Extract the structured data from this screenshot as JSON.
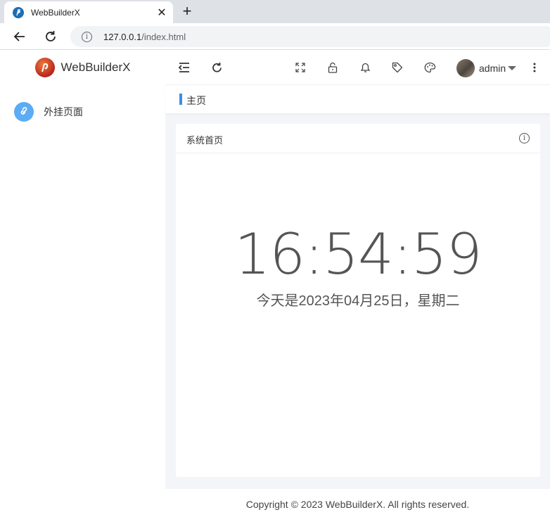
{
  "browser": {
    "tab_title": "WebBuilderX",
    "close_glyph": "✕",
    "new_tab_glyph": "+",
    "url_host": "127.0.0.1",
    "url_path": "/index.html",
    "info_glyph": "i"
  },
  "sidebar": {
    "brand_name": "WebBuilderX",
    "items": [
      {
        "label": "外挂页面",
        "icon": "link-icon"
      }
    ]
  },
  "header": {
    "icons": [
      "menu-fold-icon",
      "refresh-icon",
      "fullscreen-icon",
      "lock-icon",
      "bell-icon",
      "tag-icon",
      "palette-icon",
      "more-icon"
    ],
    "username": "admin"
  },
  "breadcrumb": {
    "current": "主页"
  },
  "card": {
    "title": "系统首页",
    "info_glyph": "i",
    "time": "16:54:59",
    "date": "今天是2023年04月25日，星期二"
  },
  "footer": {
    "copyright": "Copyright © 2023 WebBuilderX. All rights reserved."
  },
  "colors": {
    "accent": "#3b8ee8",
    "menu_icon_bg": "#5cabf5",
    "text": "#333333"
  }
}
